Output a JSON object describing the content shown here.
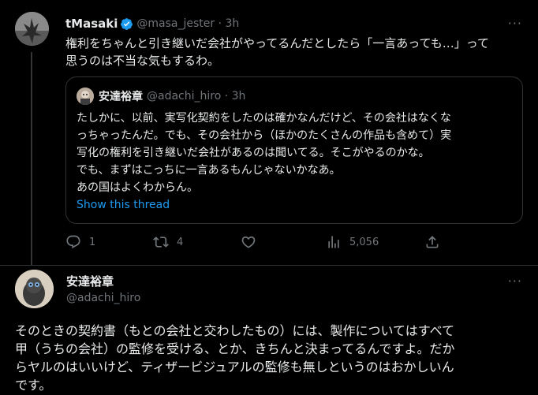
{
  "quoted_tweet": {
    "author_name": "tMasaki",
    "author_handle": "@masa_jester",
    "time": "3h",
    "more_icon": "ellipsis-icon",
    "text": "権利をちゃんと引き継いだ会社がやってるんだとしたら「一言あっても…」って\n思うのは不当な気もするわ。",
    "quote": {
      "author_name": "安達裕章",
      "author_handle": "@adachi_hiro",
      "time": "3h",
      "text": "たしかに、以前、実写化契約をしたのは確かなんだけど、その会社はなくな\nっちゃったんだ。でも、その会社から（ほかのたくさんの作品も含めて）実\n写化の権利を引き継いだ会社があるのは聞いてる。そこがやるのかな。\nでも、まずはこっちに一言あるもんじゃないかなあ。\nあの国はよくわからん。",
      "show_thread": "Show this thread"
    },
    "actions": {
      "replies": "1",
      "retweets": "4",
      "likes": "",
      "views": "5,056"
    }
  },
  "main_tweet": {
    "author_name": "安達裕章",
    "author_handle": "@adachi_hiro",
    "more_icon": "ellipsis-icon",
    "text": "そのときの契約書（もとの会社と交わしたもの）には、製作についてはすべて\n甲（うちの会社）の監修を受ける、とか、きちんと決まってるんですよ。だか\nらヤルのはいいけど、ティザービジュアルの監修も無しというのはおかしいん\nです。"
  },
  "colors": {
    "background": "#000000",
    "text": "#e7e9ea",
    "secondary": "#71767b",
    "link": "#1d9bf0",
    "border": "#2f3336"
  }
}
